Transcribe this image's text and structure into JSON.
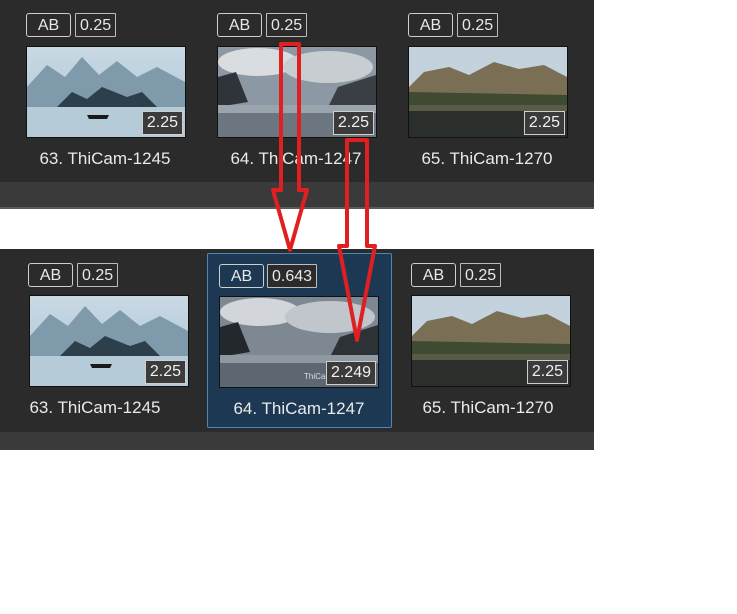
{
  "strip_top": {
    "cells": [
      {
        "ab_label": "AB",
        "value": "0.25",
        "magnification": "2.25",
        "caption": "63. ThiCam-1245",
        "thumb": "lake-boat"
      },
      {
        "ab_label": "AB",
        "value": "0.25",
        "magnification": "2.25",
        "caption": "64. ThiCam-1247",
        "thumb": "lake-clouds"
      },
      {
        "ab_label": "AB",
        "value": "0.25",
        "magnification": "2.25",
        "caption": "65. ThiCam-1270",
        "thumb": "cliffs"
      }
    ]
  },
  "strip_bottom": {
    "cells": [
      {
        "ab_label": "AB",
        "value": "0.25",
        "magnification": "2.25",
        "caption": "63. ThiCam-1245",
        "thumb": "lake-boat",
        "selected": false
      },
      {
        "ab_label": "AB",
        "value": "0.643",
        "magnification": "2.249",
        "caption": "64. ThiCam-1247",
        "thumb": "lake-clouds",
        "selected": true,
        "watermark": "ThiCam"
      },
      {
        "ab_label": "AB",
        "value": "0.25",
        "magnification": "2.25",
        "caption": "65. ThiCam-1270",
        "thumb": "cliffs",
        "selected": false
      }
    ]
  },
  "annotation": {
    "arrow_color": "#e02020",
    "arrow_count": 2
  }
}
